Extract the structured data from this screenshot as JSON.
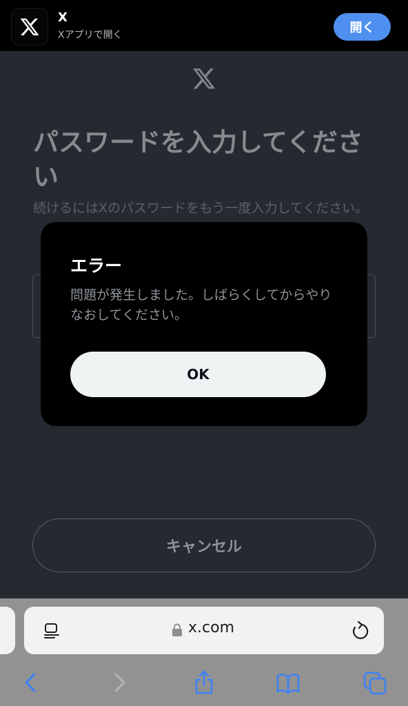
{
  "banner": {
    "app_name": "X",
    "subtitle": "Xアプリで開く",
    "open_label": "開く"
  },
  "page": {
    "title": "パスワードを入力してください",
    "description": "続けるにはXのパスワードをもう一度入力してください。",
    "cancel_label": "キャンセル"
  },
  "dialog": {
    "title": "エラー",
    "message": "問題が発生しました。しばらくしてからやりなおしてください。",
    "ok_label": "OK"
  },
  "browser": {
    "url": "x.com"
  },
  "colors": {
    "banner_bg": "#000000",
    "page_bg": "#252a31",
    "open_button": "#4f8ff0",
    "dialog_bg": "#000000",
    "ok_button_bg": "#eff3f4",
    "safari_tint": "#3a82f7"
  },
  "icons": {
    "banner_icon": "x-logo-icon",
    "page_logo": "x-logo-icon",
    "reader": "reader-mode-icon",
    "lock": "lock-icon",
    "reload": "reload-icon",
    "back": "chevron-left-icon",
    "forward": "chevron-right-icon",
    "share": "share-icon",
    "bookmarks": "bookmarks-book-icon",
    "tabs": "tabs-icon"
  }
}
